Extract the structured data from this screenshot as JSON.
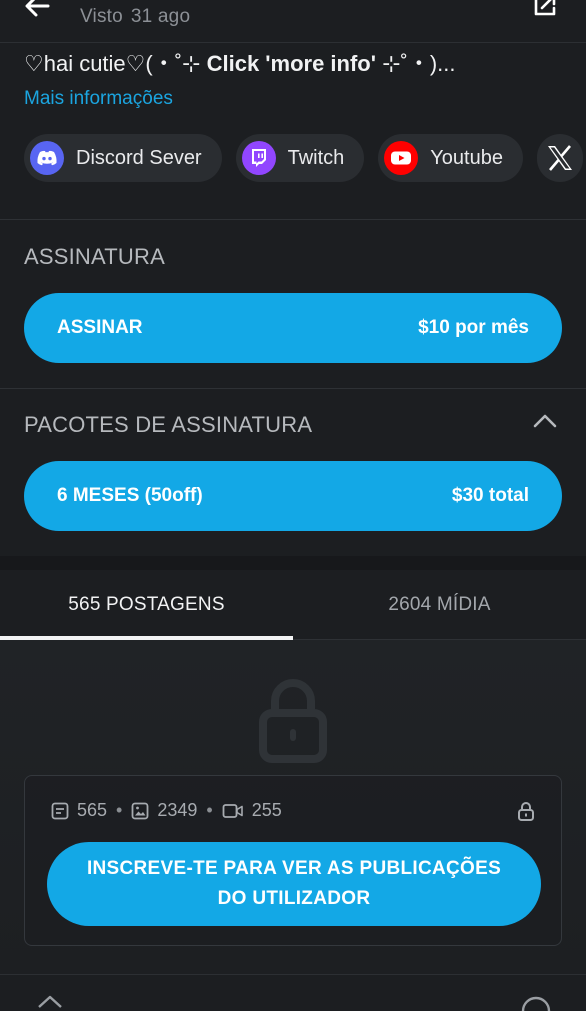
{
  "header": {
    "seen_label": "Visto",
    "seen_time": "31 ago"
  },
  "profile": {
    "bio_prefix": "♡hai cutie♡(・˚⊹ ",
    "bio_bold": "Click 'more info'",
    "bio_suffix": " ⊹˚・)...",
    "more_info_link": "Mais informações"
  },
  "socials": [
    {
      "label": "Discord Sever",
      "icon": "discord-icon",
      "color": "#5865f2"
    },
    {
      "label": "Twitch",
      "icon": "twitch-icon",
      "color": "#9146ff"
    },
    {
      "label": "Youtube",
      "icon": "youtube-icon",
      "color": "#ff0000"
    },
    {
      "label": "",
      "icon": "x-icon",
      "color": "#ffffff"
    }
  ],
  "subscription": {
    "title": "ASSINATURA",
    "button_label": "ASSINAR",
    "button_price": "$10 por mês"
  },
  "bundles": {
    "title": "PACOTES DE ASSINATURA",
    "items": [
      {
        "label": "6 MESES (50off)",
        "price": "$30 total"
      }
    ]
  },
  "tabs": [
    {
      "label": "565 POSTAGENS",
      "active": true
    },
    {
      "label": "2604 MÍDIA",
      "active": false
    }
  ],
  "locked_content": {
    "posts_count": "565",
    "images_count": "2349",
    "videos_count": "255",
    "separator": "•",
    "cta_label": "INSCREVE-TE PARA VER AS PUBLICAÇÕES DO UTILIZADOR"
  },
  "colors": {
    "accent": "#13a8e6",
    "link": "#1ba5e0",
    "background": "#1c1e21"
  }
}
